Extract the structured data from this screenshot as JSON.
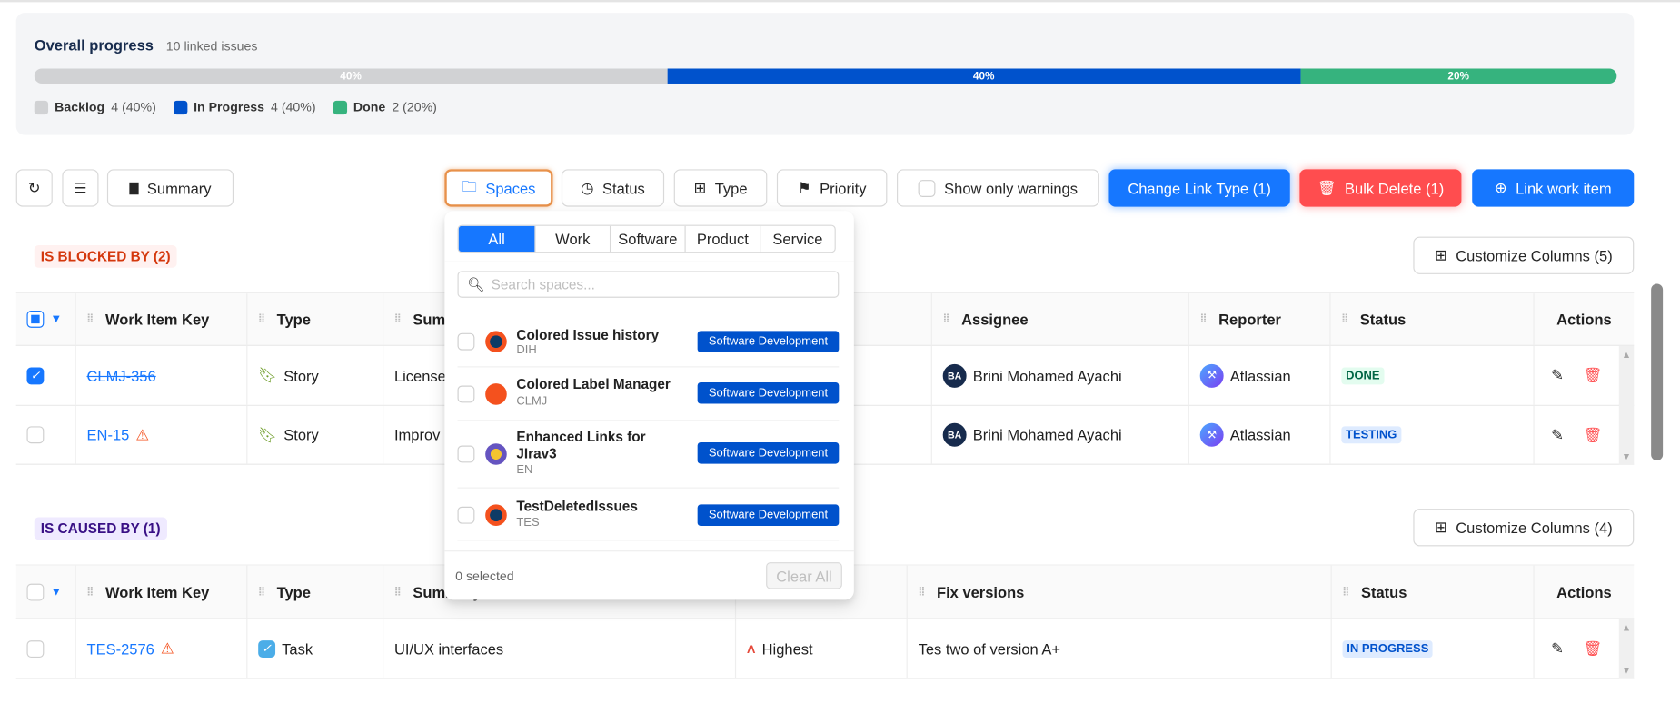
{
  "progress": {
    "title": "Overall progress",
    "subtitle": "10 linked issues",
    "segments": [
      {
        "label": "40%",
        "pct": 40,
        "color": "#d1d2d4"
      },
      {
        "label": "40%",
        "pct": 40,
        "color": "#0052cc"
      },
      {
        "label": "20%",
        "pct": 20,
        "color": "#36b37e"
      }
    ],
    "legend": [
      {
        "name": "Backlog",
        "count": "4 (40%)",
        "color": "#d1d2d4"
      },
      {
        "name": "In Progress",
        "count": "4 (40%)",
        "color": "#0052cc"
      },
      {
        "name": "Done",
        "count": "2 (20%)",
        "color": "#36b37e"
      }
    ]
  },
  "toolbar": {
    "summary": "Summary",
    "spaces": "Spaces",
    "status": "Status",
    "type": "Type",
    "priority": "Priority",
    "warnings": "Show only warnings",
    "change_link": "Change Link Type (1)",
    "bulk_delete": "Bulk Delete (1)",
    "link_item": "Link work item"
  },
  "blocked": {
    "badge": "IS BLOCKED BY (2)",
    "customize": "Customize Columns (5)",
    "headers": {
      "key": "Work Item Key",
      "type": "Type",
      "summary": "Summary",
      "assignee": "Assignee",
      "reporter": "Reporter",
      "status": "Status",
      "actions": "Actions"
    },
    "rows": [
      {
        "key": "CLMJ-356",
        "type": "Story",
        "summary": "License",
        "assignee": "Brini Mohamed Ayachi",
        "assignee_initials": "BA",
        "reporter": "Atlassian",
        "status": "DONE",
        "checked": true
      },
      {
        "key": "EN-15",
        "type": "Story",
        "summary": "Improv",
        "assignee": "Brini Mohamed Ayachi",
        "assignee_initials": "BA",
        "reporter": "Atlassian",
        "status": "TESTING",
        "checked": false
      }
    ]
  },
  "caused": {
    "badge": "IS CAUSED BY (1)",
    "customize": "Customize Columns (4)",
    "headers": {
      "key": "Work Item Key",
      "type": "Type",
      "summary": "Summary",
      "fix": "Fix versions",
      "status": "Status",
      "actions": "Actions"
    },
    "rows": [
      {
        "key": "TES-2576",
        "type": "Task",
        "summary": "UI/UX interfaces",
        "priority": "Highest",
        "fix": "Tes two of version A+",
        "status": "IN PROGRESS"
      }
    ]
  },
  "dropdown": {
    "tabs": [
      "All",
      "Work",
      "Software",
      "Product",
      "Service"
    ],
    "search_placeholder": "Search spaces...",
    "items": [
      {
        "name": "Colored Issue history",
        "key": "DIH",
        "tag": "Software Development"
      },
      {
        "name": "Colored Label Manager",
        "key": "CLMJ",
        "tag": "Software Development"
      },
      {
        "name": "Enhanced Links for JIrav3",
        "key": "EN",
        "tag": "Software Development"
      },
      {
        "name": "TestDeletedIssues",
        "key": "TES",
        "tag": "Software Development"
      }
    ],
    "selected": "0 selected",
    "clear": "Clear All"
  }
}
